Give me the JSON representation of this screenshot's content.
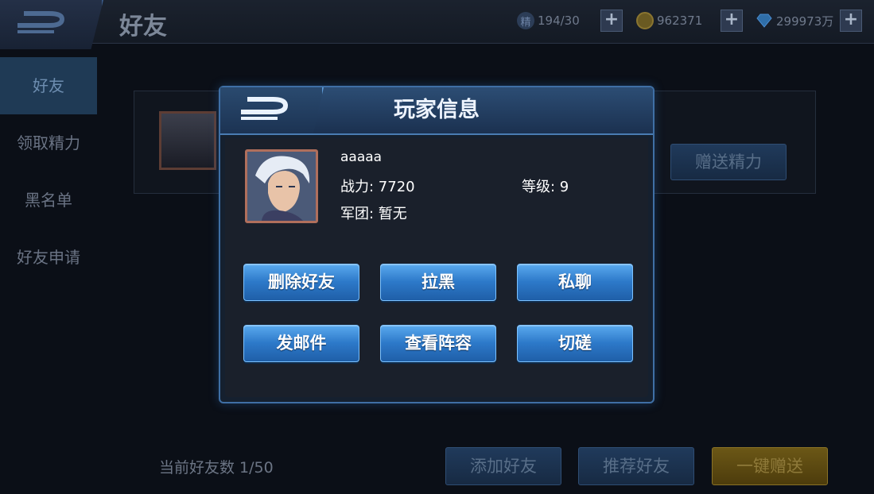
{
  "header": {
    "title": "好友",
    "stamina": {
      "icon": "stamina-icon",
      "glyph": "精",
      "value": "194/30"
    },
    "gold": {
      "icon": "gold-coin-icon",
      "value": "962371"
    },
    "diamond": {
      "icon": "diamond-icon",
      "value": "299973万"
    },
    "plus_label": "+"
  },
  "sidebar": {
    "items": [
      {
        "label": "好友",
        "active": true
      },
      {
        "label": "领取精力",
        "active": false
      },
      {
        "label": "黑名单",
        "active": false
      },
      {
        "label": "好友申请",
        "active": false
      }
    ]
  },
  "friend_list": {
    "gift_button": "赠送精力"
  },
  "footer": {
    "friend_count": "当前好友数 1/50",
    "add_friend": "添加好友",
    "recommend_friend": "推荐好友",
    "gift_all": "一键赠送"
  },
  "modal": {
    "title": "玩家信息",
    "player": {
      "name": "aaaaa",
      "power": "战力: 7720",
      "level": "等级: 9",
      "guild": "军团: 暂无"
    },
    "actions": [
      "删除好友",
      "拉黑",
      "私聊",
      "发邮件",
      "查看阵容",
      "切磋"
    ]
  },
  "colors": {
    "accent": "#3f6fa5",
    "button_blue": "#2d79c9",
    "avatar_border": "#b06f5c"
  }
}
